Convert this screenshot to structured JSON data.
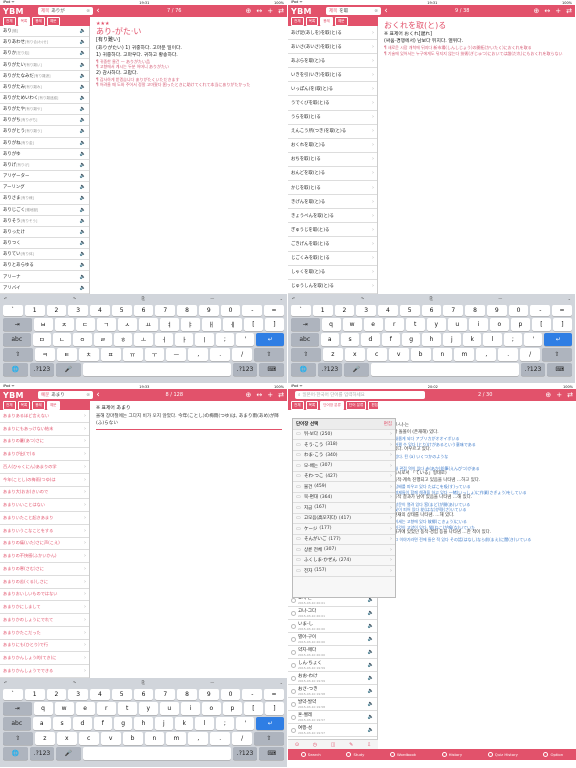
{
  "accent_color": "#e2526b",
  "panels": [
    {
      "status": {
        "left": "iPad ᯤ",
        "time": "19:31",
        "right": "100%"
      },
      "logo": "YBM",
      "search": {
        "filter": "제목",
        "query": "ありが"
      },
      "counter": "7 / 76",
      "tools": [
        "⊕",
        "↔",
        "+",
        "⇄"
      ],
      "tabs": [
        "전체",
        "목록",
        "용례",
        "예문"
      ],
      "active_tab": 1,
      "words": [
        {
          "w": "あり",
          "k": "[蟻]"
        },
        {
          "w": "ありあわせ",
          "k": "[有り合(わ)せ]"
        },
        {
          "w": "ありか",
          "k": "[在り処]"
        },
        {
          "w": "ありがたい",
          "k": "[有り難い]"
        },
        {
          "w": "ありがたなみだ",
          "k": "[有り難涙]"
        },
        {
          "w": "ありがたみ",
          "k": "[有り難み]"
        },
        {
          "w": "ありがためいわく",
          "k": "[有り難迷惑]"
        },
        {
          "w": "ありがたや",
          "k": "[有り難や]"
        },
        {
          "w": "ありがち",
          "k": "[有りがち]"
        },
        {
          "w": "ありがとう",
          "k": "[有り難う]"
        },
        {
          "w": "ありがね",
          "k": "[有り金]"
        },
        {
          "w": "ありがゆ",
          "k": ""
        },
        {
          "w": "ありげ",
          "k": "[有りげ]"
        },
        {
          "w": "アリゲーター",
          "k": ""
        },
        {
          "w": "アーリング",
          "k": ""
        },
        {
          "w": "ありさま",
          "k": "[有り様]"
        },
        {
          "w": "ありじごく",
          "k": "[蟻地獄]"
        },
        {
          "w": "ありそう",
          "k": "[有りそう]"
        },
        {
          "w": "ありったけ",
          "k": ""
        },
        {
          "w": "ありつく",
          "k": ""
        },
        {
          "w": "ありてい",
          "k": "[有り体]"
        },
        {
          "w": "ありとあらゆる",
          "k": ""
        },
        {
          "w": "アリーナ",
          "k": ""
        },
        {
          "w": "アリバイ",
          "k": ""
        }
      ],
      "detail": {
        "stars": "★★★",
        "headword": "あり-がた·い",
        "kanji": "[有り難い]",
        "lines": [
          "(ありがたい) 1) 귀중하다. 고마운 일이다.",
          "1) 귀중하다. 고마우다. 귀하고 황송하다.",
          "¶ 귀중한 물건 — ありがたい品",
          "¶ 고향에서 계시는 두분 어머니 ありがたい",
          "2) 감사하다. 고맙다.",
          "¶ 감사하게 받겠습니다 ありがたくいただきます",
          "¶ 어려울 때 도와 주어서 정말 고마웠다 困ったときに助けてくれて本当にありがたかった"
        ]
      },
      "keyboard": {
        "toolbar": [
          "↶",
          "↷",
          "⎘",
          "—",
          "⌄"
        ],
        "rows": [
          [
            "`",
            "1",
            "2",
            "3",
            "4",
            "5",
            "6",
            "7",
            "8",
            "9",
            "0",
            "-",
            "="
          ],
          [
            "⇥",
            "ㅂ",
            "ㅈ",
            "ㄷ",
            "ㄱ",
            "ㅅ",
            "ㅛ",
            "ㅕ",
            "ㅑ",
            "ㅐ",
            "ㅔ",
            "[",
            "]"
          ],
          [
            "abc",
            "ㅁ",
            "ㄴ",
            "ㅇ",
            "ㄹ",
            "ㅎ",
            "ㅗ",
            "ㅓ",
            "ㅏ",
            "ㅣ",
            ";",
            "'",
            "↵"
          ],
          [
            "⇧",
            "ㅋ",
            "ㅌ",
            "ㅊ",
            "ㅍ",
            "ㅠ",
            "ㅜ",
            "ㅡ",
            ",",
            ".",
            "/",
            "⇧"
          ],
          [
            "🌐",
            ".?123",
            "🎤",
            " ",
            ".?123",
            "⌨"
          ]
        ]
      }
    },
    {
      "status": {
        "left": "iPad ᯤ",
        "time": "19:31",
        "right": "100%"
      },
      "logo": "YBM",
      "search": {
        "filter": "제목",
        "query": "を取"
      },
      "counter": "9 / 38",
      "tools": [
        "⊕",
        "↔",
        "+",
        "⇄"
      ],
      "tabs": [
        "전체",
        "목록",
        "용례",
        "예문"
      ],
      "active_tab": 2,
      "words": [
        {
          "w": "あげ足(あしを)を取(と)る",
          "k": ""
        },
        {
          "w": "あいさ(あいさ)を取(と)る",
          "k": ""
        },
        {
          "w": "あぶらを取(と)る",
          "k": ""
        },
        {
          "w": "いきを引(いき)を取(と)る",
          "k": ""
        },
        {
          "w": "いっぽん(を)取(と)る",
          "k": ""
        },
        {
          "w": "うでくびを取(と)る",
          "k": ""
        },
        {
          "w": "うらを取(と)る",
          "k": ""
        },
        {
          "w": "えんこう所(つき)を取(と)る",
          "k": ""
        },
        {
          "w": "おくれを取(と)る",
          "k": ""
        },
        {
          "w": "おちを取(と)る",
          "k": ""
        },
        {
          "w": "おんどを取(と)る",
          "k": ""
        },
        {
          "w": "かじを取(と)る",
          "k": ""
        },
        {
          "w": "きげんを取(と)る",
          "k": ""
        },
        {
          "w": "きょうべんを取(と)る",
          "k": ""
        },
        {
          "w": "ぎゅうじを取(と)る",
          "k": ""
        },
        {
          "w": "ごきげんを取(と)る",
          "k": ""
        },
        {
          "w": "じごくみを取(と)る",
          "k": ""
        },
        {
          "w": "しゃくを取(と)る",
          "k": ""
        },
        {
          "w": "じゅうしんを取(と)る",
          "k": ""
        }
      ],
      "detail": {
        "stars": "",
        "headword": "おくれを取(と)る",
        "kanji": "",
        "lines": [
          "※ 표제어  おくれ[遅れ]",
          "(싸움·경쟁에서) 남보다 뒤지다. 열위다.",
          "¶ 새로운 시장 개척에 뒤지다 新市場(しんしじょう)の開拓(かいたく)におくれを取る",
          "¶ 기술에 있어서는 누구에게도 뒤지지 않는다 技術(ぎじゅつ)においては誰(だれ)にもおくれを取らない"
        ]
      },
      "keyboard": {
        "toolbar": [
          "↶",
          "↷",
          "⎘",
          "—",
          "⌄"
        ],
        "rows": [
          [
            "`",
            "1",
            "2",
            "3",
            "4",
            "5",
            "6",
            "7",
            "8",
            "9",
            "0",
            "-",
            "="
          ],
          [
            "⇥",
            "q",
            "w",
            "e",
            "r",
            "t",
            "y",
            "u",
            "i",
            "o",
            "p",
            "[",
            "]"
          ],
          [
            "abc",
            "a",
            "s",
            "d",
            "f",
            "g",
            "h",
            "j",
            "k",
            "l",
            ";",
            "'",
            "↵"
          ],
          [
            "⇧",
            "z",
            "x",
            "c",
            "v",
            "b",
            "n",
            "m",
            ",",
            ".",
            "/",
            "⇧"
          ],
          [
            "🌐",
            ".?123",
            "🎤",
            " ",
            ".?123",
            "⌨"
          ]
        ]
      }
    },
    {
      "status": {
        "left": "iPad ᯤ",
        "time": "19:33",
        "right": "100%"
      },
      "logo": "YBM",
      "search": {
        "filter": "예문",
        "query": "あまり"
      },
      "counter": "8 / 128",
      "tools": [
        "⊕",
        "↔",
        "+",
        "⇄"
      ],
      "tabs": [
        "전체",
        "목록",
        "용례",
        "예문"
      ],
      "active_tab": 3,
      "words": [
        {
          "w": "あまりあるほど言えない",
          "k": ""
        },
        {
          "w": "あまりにもあっけない結末",
          "k": ""
        },
        {
          "w": "あまりの暑(あつ)さに",
          "k": ""
        },
        {
          "w": "あまりが出(で)る",
          "k": ""
        },
        {
          "w": "百人(ひゃくにん)あまりの学",
          "k": ""
        },
        {
          "w": "今年(ことし)の梅雨(つゆ)は",
          "k": ""
        },
        {
          "w": "あまり大(おお)きいので",
          "k": ""
        },
        {
          "w": "あまりいいことはない",
          "k": ""
        },
        {
          "w": "あまりいたこと起きあまり",
          "k": ""
        },
        {
          "w": "あまりいうこなことをする",
          "k": ""
        },
        {
          "w": "あまりの痛(いた)さに声(こえ)",
          "k": ""
        },
        {
          "w": "あまりの不快感(ふかいかん)",
          "k": ""
        },
        {
          "w": "あまりの寒(さむ)さに",
          "k": ""
        },
        {
          "w": "あまりの苦(くる)しさに",
          "k": ""
        },
        {
          "w": "あまりおいしいものではない",
          "k": ""
        },
        {
          "w": "あまりかにしまして",
          "k": ""
        },
        {
          "w": "あまりかのしょうにでれて",
          "k": ""
        },
        {
          "w": "あまりかたこだった",
          "k": ""
        },
        {
          "w": "あまりにも(ひとり)で行",
          "k": ""
        },
        {
          "w": "あまりかんしょう的(てき)に",
          "k": ""
        },
        {
          "w": "あまりかんしょうでできる",
          "k": ""
        }
      ],
      "detail": {
        "stars": "",
        "headword": "",
        "kanji": "",
        "lines": [
          "※ 표제어  あまり",
          "올해 장마철에는 그다지 비가 오지 않았다. 今年(ことし)の梅雨(つゆ)は, あまり雨(あめ)が降(ふ)らない"
        ]
      },
      "keyboard": {
        "toolbar": [
          "↶",
          "↷",
          "⎘",
          "—",
          "⌄"
        ],
        "rows": [
          [
            "`",
            "1",
            "2",
            "3",
            "4",
            "5",
            "6",
            "7",
            "8",
            "9",
            "0",
            "-",
            "="
          ],
          [
            "⇥",
            "q",
            "w",
            "e",
            "r",
            "t",
            "y",
            "u",
            "i",
            "o",
            "p",
            "[",
            "]"
          ],
          [
            "abc",
            "a",
            "s",
            "d",
            "f",
            "g",
            "h",
            "j",
            "k",
            "l",
            ";",
            "'",
            "↵"
          ],
          [
            "⇧",
            "z",
            "x",
            "c",
            "v",
            "b",
            "n",
            "m",
            ",",
            ".",
            "/",
            "⇧"
          ],
          [
            "🌐",
            ".?123",
            "🎤",
            " ",
            ".?123",
            "⌨"
          ]
        ]
      }
    },
    {
      "status": {
        "left": "iPad ᯤ",
        "time": "20:02",
        "right": "100%"
      },
      "search": {
        "placeholder": "일본어·한국어 단어를 입력하세요"
      },
      "counter": "2 / 30",
      "tools": [
        "⊕",
        "+",
        "⇄"
      ],
      "tabs": [
        "전체",
        "목록",
        "단어장 분류",
        "단어 분류",
        "편집"
      ],
      "wordbook": {
        "title": "단어장 선택",
        "edit": "편집",
        "items": [
          {
            "name": "뒤-보다",
            "count": "(250)"
          },
          {
            "name": "そう·こう",
            "count": "(318)"
          },
          {
            "name": "わま·こう",
            "count": "(340)"
          },
          {
            "name": "모-배는",
            "count": "(307)"
          },
          {
            "name": "そわ·つこ",
            "count": "(427)"
          },
          {
            "name": "물건",
            "count": "(459)"
          },
          {
            "name": "북-편대",
            "count": "(364)"
          },
          {
            "name": "지금",
            "count": "(167)"
          },
          {
            "name": "고모음(高모지다)",
            "count": "(417)"
          },
          {
            "name": "ケージ",
            "count": "(177)"
          },
          {
            "name": "そんがいご",
            "count": "(177)"
          },
          {
            "name": "상륜 전체",
            "count": "(307)"
          },
          {
            "name": "ふくしま·かぜん",
            "count": "(274)"
          },
          {
            "name": "전자",
            "count": "(157)"
          }
        ]
      },
      "history": [
        {
          "w": "표지-는",
          "d": "2015-03-10 20:01"
        },
        {
          "w": "고나-그다",
          "d": "2015-03-10 20:01"
        },
        {
          "w": "いま-し",
          "d": "2015-03-10 20:00"
        },
        {
          "w": "별아-구이",
          "d": "2015-03-10 20:00"
        },
        {
          "w": "약지-매다",
          "d": "2015-03-10 20:00"
        },
        {
          "w": "しん·ちょく",
          "d": "2015-03-10 19:59"
        },
        {
          "w": "おお-わけ",
          "d": "2015-03-10 19:59"
        },
        {
          "w": "おさ-つき",
          "d": "2015-03-10 19:58"
        },
        {
          "w": "발약-발약",
          "d": "2015-03-10 19:58"
        },
        {
          "w": "혼-벨레",
          "d": "2015-03-10 19:57"
        },
        {
          "w": "여행-성",
          "d": "2015-03-10 19:57"
        }
      ],
      "right_lines": [
        "... 고-나-는",
        "① 나 돌볼이 (존재해) 있다.",
        "예) 새롭게 되다 アブリカがオオイボいる",
        "예) 어쩔 수 있다 (とり)けがあるという意味である",
        "② 있다. 어우르고 있다.",
        "예) 있다. 된 (a) いくつかのような",
        "다.",
        "예) 내 관점 역이 있다 赤(あか)鉛筆(えんぴつ)がある",
        "③ 동시로서 「ている」형태로)",
        "③ 동작·계속 진행되고 있음을 나타냄 …하고 있다.",
        "예) 담배를 피우고 있다 たばこを吸(す)っている",
        "예) 형제들이 함께 해결을 하고 있다 一緒(いっしょ)に作業(さぎょう)をしている",
        "④ 동작 결과가 남아 있음을 나타냄 …해 있다.",
        "예) 창문이 열려 있다 窓(まど)が開(あ)いている",
        "예) 꽃이 피어 있다 花(はな)が咲(さ)いている",
        "⑤ 현재의 상태를 나타냄. …해 있다.",
        "예) 이세는 고향에 있다 故郷(こきょう)にいる",
        "예) 이것이 고양이 있다. 猫(ねこ)が鳴(な)いていた",
        "⑥ 과거에 있었던 동작·경험 등을 나타냄 …한 적이 있다.",
        "예) 그 이야기라면 전에 들은 적 있다 その話(はなし)なら前(まえ)に聞(き)いている"
      ],
      "bottom_nav": [
        "Search",
        "Study",
        "Wordbook",
        "History",
        "Quiz History",
        "Option"
      ],
      "bottom_left_icons": [
        "⊙",
        "◷",
        "◫",
        "✎",
        "⇩"
      ]
    }
  ]
}
